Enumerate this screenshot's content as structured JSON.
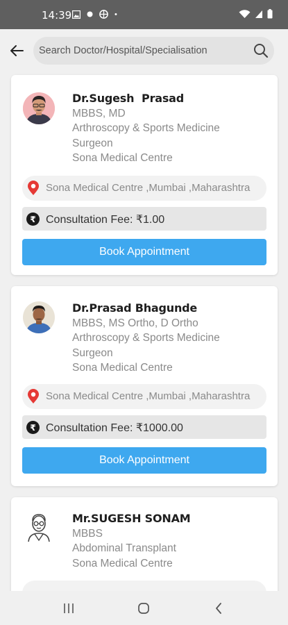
{
  "status_bar": {
    "time": "14:39",
    "dot": "•"
  },
  "search": {
    "placeholder": "Search Doctor/Hospital/Specialisation"
  },
  "doctors": [
    {
      "name": "Dr.Sugesh  Prasad",
      "qualification": "MBBS, MD",
      "specialty_line1": "Arthroscopy & Sports Medicine",
      "specialty_line2": "Surgeon",
      "hospital": "Sona Medical Centre",
      "location": "Sona Medical Centre ,Mumbai ,Maharashtra",
      "fee": "Consultation Fee: ₹1.00",
      "book_label": "Book Appointment"
    },
    {
      "name": "Dr.Prasad Bhagunde",
      "qualification": "MBBS, MS Ortho, D Ortho",
      "specialty_line1": "Arthroscopy & Sports Medicine",
      "specialty_line2": "Surgeon",
      "hospital": "Sona Medical Centre",
      "location": "Sona Medical Centre ,Mumbai ,Maharashtra",
      "fee": "Consultation Fee: ₹1000.00",
      "book_label": "Book Appointment"
    },
    {
      "name": "Mr.SUGESH SONAM",
      "qualification": "MBBS",
      "specialty_line1": "Abdominal Transplant",
      "hospital": "Sona Medical Centre"
    }
  ],
  "colors": {
    "accent": "#3ea8ef",
    "pin": "#e53935",
    "status_bar": "#5f5f5f"
  },
  "icons": [
    "back-arrow-icon",
    "search-icon",
    "location-pin-icon",
    "rupee-icon",
    "doctor-avatar-icon",
    "recent-apps-icon",
    "home-icon",
    "back-nav-icon"
  ]
}
